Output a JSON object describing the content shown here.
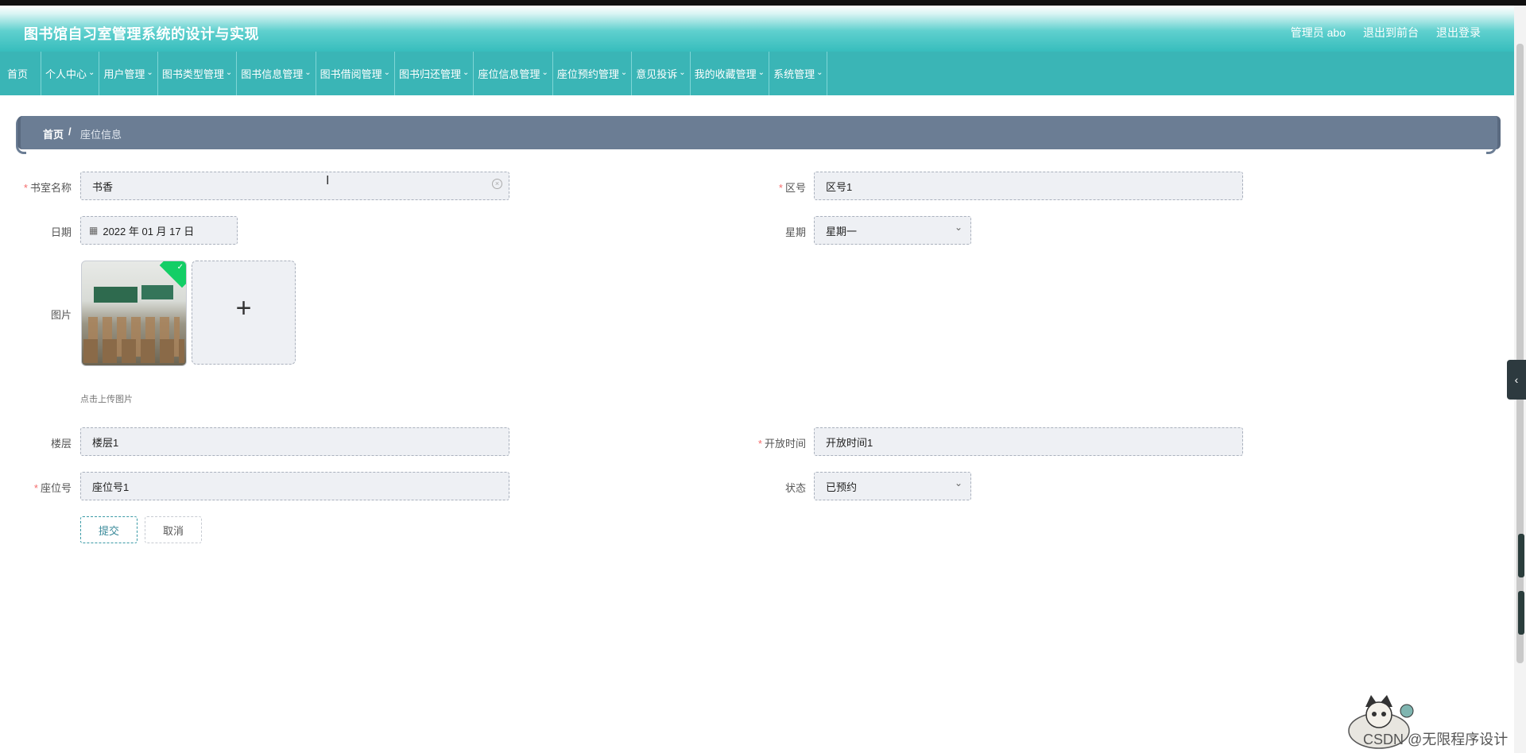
{
  "header": {
    "title": "图书馆自习室管理系统的设计与实现",
    "admin_label": "管理员 abo",
    "to_front": "退出到前台",
    "logout": "退出登录"
  },
  "nav": {
    "home": "首页",
    "items": [
      "个人中心",
      "用户管理",
      "图书类型管理",
      "图书信息管理",
      "图书借阅管理",
      "图书归还管理",
      "座位信息管理",
      "座位预约管理",
      "意见投诉",
      "我的收藏管理",
      "系统管理"
    ]
  },
  "breadcrumb": {
    "home": "首页",
    "separator": "/",
    "current": "座位信息"
  },
  "form": {
    "study_room": {
      "label": "书室名称",
      "value": "书香"
    },
    "zone": {
      "label": "区号",
      "value": "区号1"
    },
    "date": {
      "label": "日期",
      "value": "2022 年 01 月 17 日"
    },
    "weekday": {
      "label": "星期",
      "value": "星期一"
    },
    "image": {
      "label": "图片",
      "hint": "点击上传图片"
    },
    "floor": {
      "label": "楼层",
      "value": "楼层1"
    },
    "open_time": {
      "label": "开放时间",
      "value": "开放时间1"
    },
    "seat_no": {
      "label": "座位号",
      "value": "座位号1"
    },
    "status": {
      "label": "状态",
      "value": "已预约"
    },
    "required_mark": "*",
    "submit": "提交",
    "cancel": "取消"
  },
  "misc": {
    "watermark": "CSDN @无限程序设计"
  },
  "colors": {
    "header": "#37bdbd",
    "nav": "#3ab5b6",
    "breadcrumb": "#6b7d94",
    "required": "#f56c6c"
  }
}
